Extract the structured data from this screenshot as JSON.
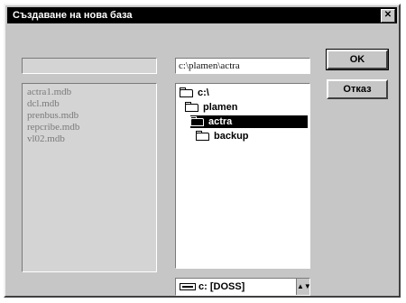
{
  "window": {
    "title": "Създаване на нова база",
    "close_glyph": "✕"
  },
  "files": [
    "actra1.mdb",
    "dcl.mdb",
    "prenbus.mdb",
    "repcribe.mdb",
    "vl02.mdb"
  ],
  "filename_value": "",
  "current_path": "c:\\plamen\\actra",
  "directories": [
    {
      "label": "c:\\",
      "selected": false
    },
    {
      "label": "plamen",
      "selected": false
    },
    {
      "label": "actra",
      "selected": true
    },
    {
      "label": "backup",
      "selected": false
    }
  ],
  "drive": {
    "value": "c: [DOSS]",
    "arrow_glyph": "▲▼"
  },
  "buttons": {
    "ok_label": "OK",
    "cancel_label": "Отказ"
  }
}
